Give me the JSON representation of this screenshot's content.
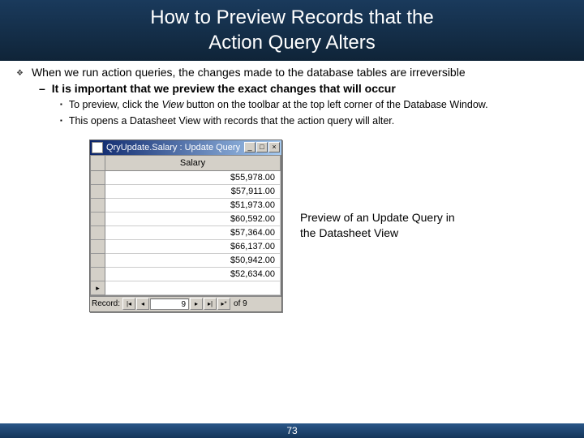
{
  "title_line1": "How to Preview Records that the",
  "title_line2": "Action Query Alters",
  "bullets": {
    "l1": "When we run action queries, the changes made to the database tables are irreversible",
    "l2": "It is important that we preview the exact changes that will occur",
    "l3a_pre": "To preview, click the ",
    "l3a_em": "View",
    "l3a_post": " button on the toolbar at the top left corner of the Database Window.",
    "l3b": "This opens a Datasheet View with records that the action query will alter."
  },
  "datasheet": {
    "window_title": "QryUpdate.Salary : Update Query",
    "column": "Salary",
    "rows": [
      "$55,978.00",
      "$57,911.00",
      "$51,973.00",
      "$60,592.00",
      "$57,364.00",
      "$66,137.00",
      "$50,942.00",
      "$52,634.00"
    ],
    "nav_label": "Record:",
    "nav_pos": "9",
    "nav_total": "of 9"
  },
  "caption": "Preview of an Update Query in the Datasheet View",
  "page_number": "73"
}
